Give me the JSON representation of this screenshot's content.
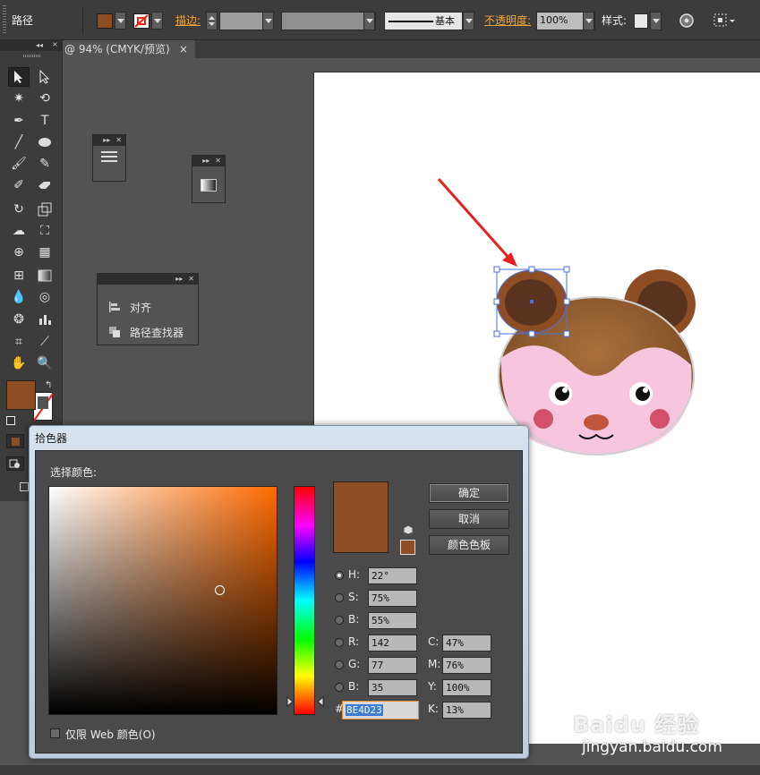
{
  "control_bar": {
    "object_type": "路径",
    "stroke_label": "描边:",
    "stroke_profile": "基本",
    "opacity_label": "不透明度:",
    "opacity_value": "100%",
    "style_label": "样式:"
  },
  "document_tab": {
    "title": "@ 94% (CMYK/预览)",
    "close": "×"
  },
  "panels": {
    "align_label": "对齐",
    "pathfinder_label": "路径查找器"
  },
  "toolbox": {
    "fill_color": "#8E4D23"
  },
  "color_picker": {
    "title": "拾色器",
    "select_color_label": "选择颜色:",
    "ok_label": "确定",
    "cancel_label": "取消",
    "swatches_label": "颜色色板",
    "hsb": [
      {
        "label": "H:",
        "value": "22°"
      },
      {
        "label": "S:",
        "value": "75%"
      },
      {
        "label": "B:",
        "value": "55%"
      }
    ],
    "rgb": [
      {
        "label": "R:",
        "value": "142"
      },
      {
        "label": "G:",
        "value": "77"
      },
      {
        "label": "B:",
        "value": "35"
      }
    ],
    "cmyk": [
      {
        "label": "C:",
        "value": "47%"
      },
      {
        "label": "M:",
        "value": "76%"
      },
      {
        "label": "Y:",
        "value": "100%"
      },
      {
        "label": "K:",
        "value": "13%"
      }
    ],
    "hex_label": "#",
    "hex_value": "8E4D23",
    "web_only_label": "仅限 Web 颜色(O)",
    "current_color": "#8E4D23"
  },
  "watermark": {
    "brand": "Baidu 经验",
    "url": "jingyan.baidu.com"
  }
}
